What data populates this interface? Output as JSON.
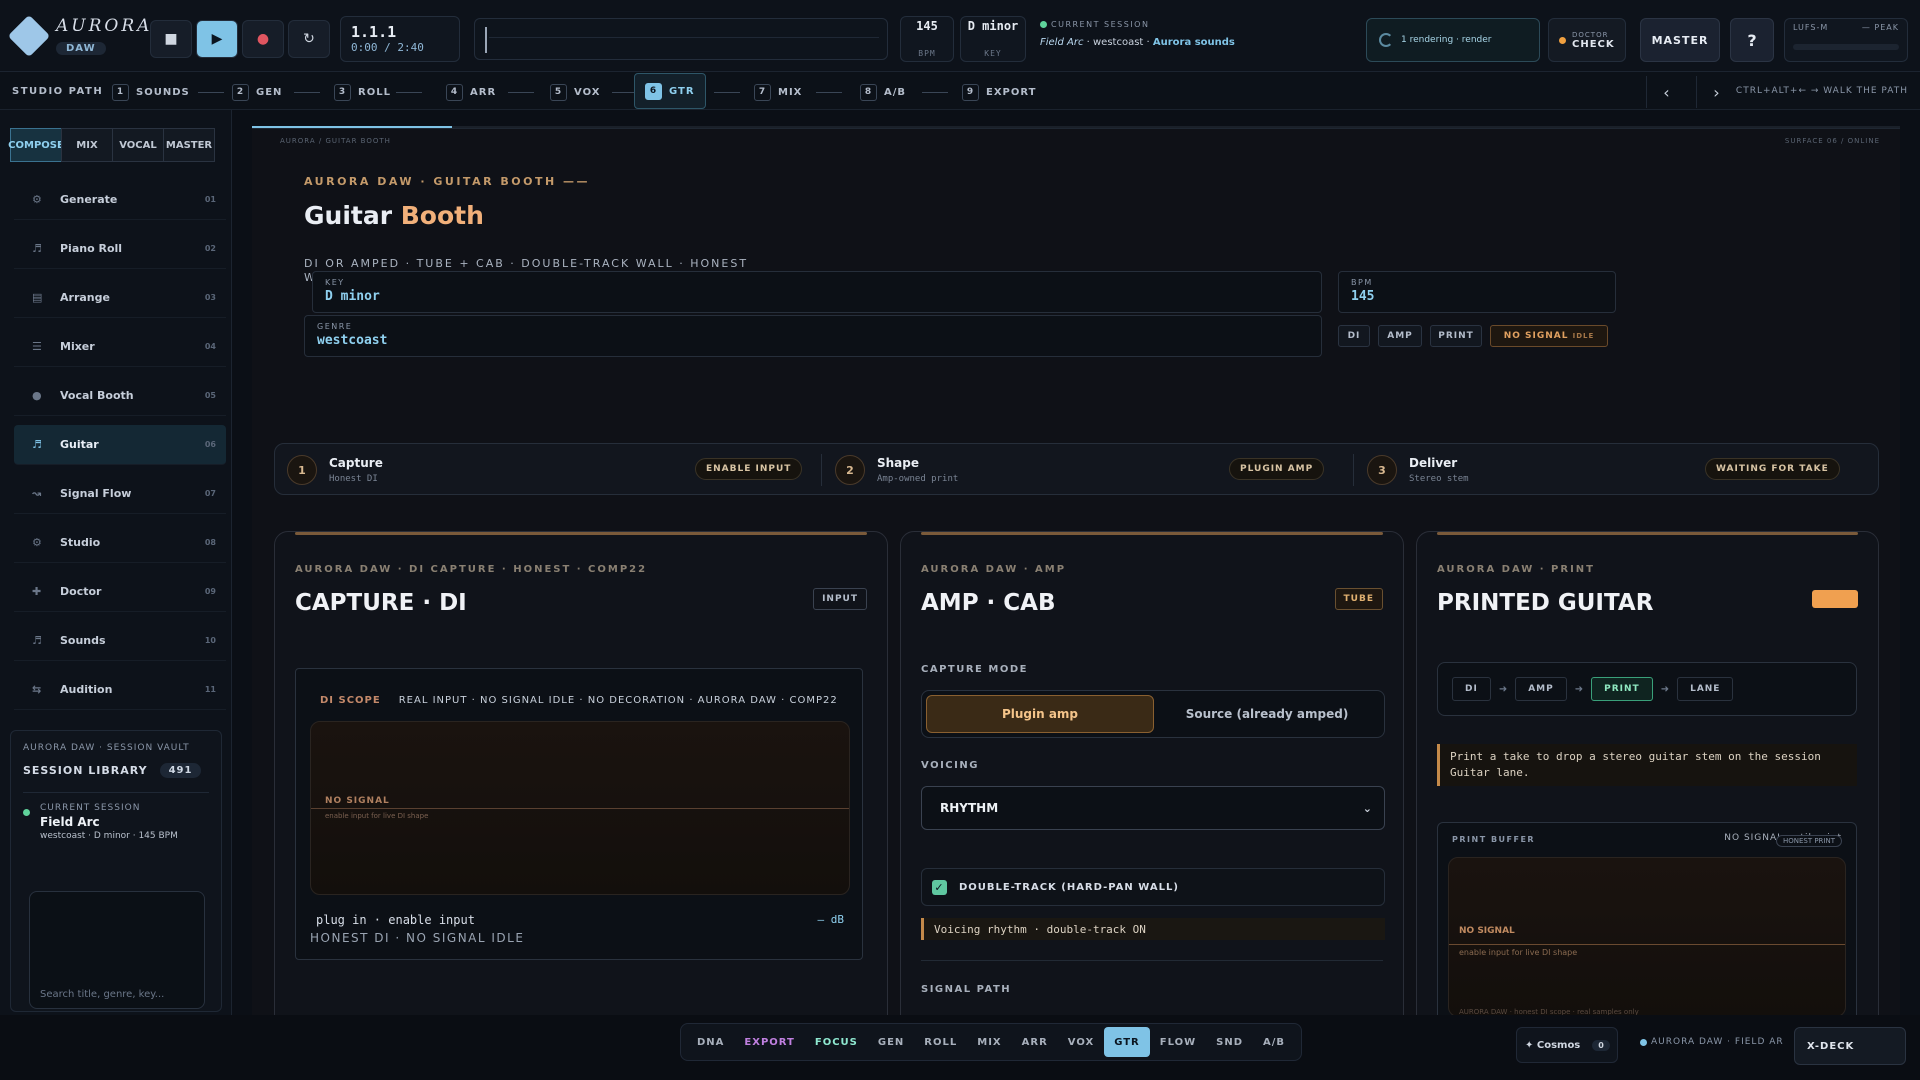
{
  "app": {
    "name": "AURORA",
    "sub": "DAW"
  },
  "transport": {
    "position": "1.1.1",
    "time": "0:00 / 2:40",
    "bpm": "145",
    "bpm_label": "BPM",
    "key": "D minor",
    "key_label": "KEY"
  },
  "session": {
    "label": "CURRENT SESSION",
    "title": "Field Arc",
    "genre": "westcoast",
    "source": "Aurora sounds"
  },
  "render": {
    "text": "1 rendering · render"
  },
  "doctor": {
    "line1": "DOCTOR",
    "line2": "CHECK"
  },
  "master_label": "MASTER",
  "help_label": "?",
  "meter": {
    "lufs": "LUFS-M",
    "peak": "— PEAK"
  },
  "path": {
    "label": "STUDIO PATH",
    "steps": [
      {
        "n": "1",
        "label": "SOUNDS"
      },
      {
        "n": "2",
        "label": "GEN"
      },
      {
        "n": "3",
        "label": "ROLL"
      },
      {
        "n": "4",
        "label": "ARR"
      },
      {
        "n": "5",
        "label": "VOX"
      },
      {
        "n": "6",
        "label": "GTR"
      },
      {
        "n": "7",
        "label": "MIX"
      },
      {
        "n": "8",
        "label": "A/B"
      },
      {
        "n": "9",
        "label": "EXPORT"
      }
    ],
    "prev": "‹",
    "next": "›",
    "shortcut": "CTRL+ALT+← → WALK THE PATH"
  },
  "modes": [
    "COMPOSE",
    "MIX",
    "VOCAL",
    "MASTER"
  ],
  "nav": [
    {
      "label": "Generate",
      "num": "01",
      "icon": "⚙"
    },
    {
      "label": "Piano Roll",
      "num": "02",
      "icon": "♬"
    },
    {
      "label": "Arrange",
      "num": "03",
      "icon": "▤"
    },
    {
      "label": "Mixer",
      "num": "04",
      "icon": "☰"
    },
    {
      "label": "Vocal Booth",
      "num": "05",
      "icon": "●"
    },
    {
      "label": "Guitar",
      "num": "06",
      "icon": "♬"
    },
    {
      "label": "Signal Flow",
      "num": "07",
      "icon": "↝"
    },
    {
      "label": "Studio",
      "num": "08",
      "icon": "⚙"
    },
    {
      "label": "Doctor",
      "num": "09",
      "icon": "✚"
    },
    {
      "label": "Sounds",
      "num": "10",
      "icon": "♬"
    },
    {
      "label": "Audition",
      "num": "11",
      "icon": "⇆"
    }
  ],
  "vault": {
    "title": "AURORA DAW · SESSION VAULT",
    "library": "SESSION LIBRARY",
    "count": "491",
    "current_label": "CURRENT SESSION",
    "name": "Field Arc",
    "meta": "westcoast · D minor · 145 BPM",
    "search_placeholder": "Search title, genre, key..."
  },
  "page": {
    "crumb": "AURORA / GUITAR BOOTH",
    "surface": "SURFACE 06 / ONLINE",
    "eyebrow": "AURORA DAW · GUITAR BOOTH ——",
    "title_a": "Guitar ",
    "title_b": "Booth",
    "subtitle": "DI OR AMPED · TUBE + CAB · DOUBLE-TRACK WALL · HONEST WAVEFORM",
    "key_label": "KEY",
    "key_value": "D minor",
    "bpm_label": "BPM",
    "bpm_value": "145",
    "genre_label": "GENRE",
    "genre_value": "westcoast",
    "pills": [
      "DI",
      "AMP",
      "PRINT"
    ],
    "signal": "NO SIGNAL",
    "signal_sub": "IDLE"
  },
  "steps": [
    {
      "n": "1",
      "title": "Capture",
      "sub": "Honest DI",
      "tag": "ENABLE INPUT"
    },
    {
      "n": "2",
      "title": "Shape",
      "sub": "Amp-owned print",
      "tag": "PLUGIN AMP"
    },
    {
      "n": "3",
      "title": "Deliver",
      "sub": "Stereo stem",
      "tag": "WAITING FOR TAKE"
    }
  ],
  "capture": {
    "eyebrow": "AURORA DAW · DI CAPTURE · HONEST · COMP22",
    "title": "CAPTURE · DI",
    "badge": "INPUT",
    "scope_label": "DI SCOPE",
    "scope_info": "REAL INPUT · NO SIGNAL IDLE · NO DECORATION · AURORA DAW · COMP22",
    "no_signal": "NO SIGNAL",
    "hint": "enable input for live DI shape",
    "foot1": "plug in · enable input",
    "foot2": "HONEST DI · NO SIGNAL IDLE",
    "db": "— dB"
  },
  "amp": {
    "eyebrow": "AURORA DAW · AMP",
    "title": "AMP · CAB",
    "badge": "TUBE",
    "mode_label": "CAPTURE MODE",
    "mode_options": [
      "Plugin amp",
      "Source (already amped)"
    ],
    "voicing_label": "VOICING",
    "voicing_value": "RHYTHM",
    "double_track": "DOUBLE-TRACK (HARD-PAN WALL)",
    "status": "Voicing rhythm · double-track ON",
    "signal_path": "SIGNAL PATH"
  },
  "print": {
    "eyebrow": "AURORA DAW · PRINT",
    "title": "PRINTED GUITAR",
    "chain": [
      "DI",
      "AMP",
      "PRINT",
      "LANE"
    ],
    "note": "Print a take to drop a stereo guitar stem on the session Guitar lane.",
    "buffer_label": "PRINT BUFFER",
    "buffer_state": "NO SIGNAL until print",
    "honest": "HONEST PRINT",
    "no_signal": "NO SIGNAL",
    "hint": "enable input for live DI shape",
    "tiny": "AURORA DAW · honest DI scope · real samples only"
  },
  "dock": {
    "tabs": [
      "DNA",
      "EXPORT",
      "FOCUS",
      "GEN",
      "ROLL",
      "MIX",
      "ARR",
      "VOX",
      "GTR",
      "FLOW",
      "SND",
      "A/B"
    ],
    "cosmos": "✦ Cosmos",
    "cosmos_count": "0",
    "field": "AURORA DAW · FIELD AR",
    "xdeck": "X-DECK"
  },
  "colors": {
    "accent": "#7fc3e6",
    "warm": "#f1b07a",
    "ok": "#5fc7a0"
  }
}
